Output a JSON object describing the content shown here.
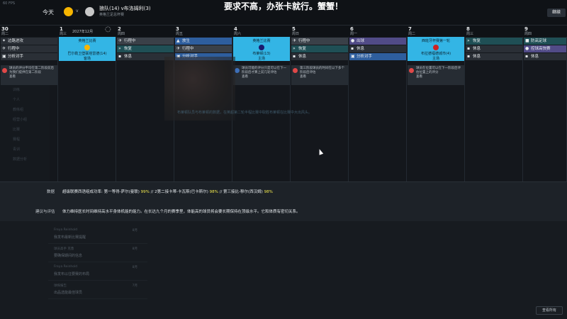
{
  "top": {
    "fps": "60 FPS",
    "today": "今天",
    "home_logo_color": "#f7b500",
    "away_logo_color": "#c8c8c8",
    "match_title": "狼队(14) v布洛姆利(3)",
    "match_sub": "英格兰足总杯赛",
    "banner": "要求不高，办张卡就行。蟹蟹！",
    "continue": "继续"
  },
  "calendar": {
    "month_label": "2027年12月",
    "days": [
      {
        "num": "30",
        "name": "周二"
      },
      {
        "num": "1",
        "name": "周三"
      },
      {
        "num": "2",
        "name": "周四"
      },
      {
        "num": "3",
        "name": "周五"
      },
      {
        "num": "4",
        "name": "周六"
      },
      {
        "num": "5",
        "name": "周日"
      },
      {
        "num": "6",
        "name": "周一"
      },
      {
        "num": "7",
        "name": "周二"
      },
      {
        "num": "8",
        "name": "周三"
      },
      {
        "num": "9",
        "name": "周四"
      }
    ],
    "col0": [
      "边路进攻",
      "行程中",
      "分析对手"
    ],
    "col1_match": {
      "title": "英格兰比赛",
      "name": "巴尔勒卫登联塔雷德(14)",
      "sub": "客场",
      "logo": "#f7b500"
    },
    "col2": [
      "行程中",
      "恢复",
      "休息"
    ],
    "col3": [
      "放生",
      "行程中",
      "分析对手"
    ],
    "col4_match": {
      "title": "英格兰比赛",
      "name": "布莱顿(13)",
      "sub": "主场",
      "logo": "#1a1a6e"
    },
    "col5": [
      "行程中",
      "恢复",
      "休息"
    ],
    "col6": [
      "出球",
      "休息",
      "分析对手"
    ],
    "col7_match": {
      "title": "西班牙杯赛第一轮",
      "name": "布拉德福德城市(4)",
      "sub": "主场",
      "logo": "#cc2222"
    },
    "col8": [
      "恢复",
      "休息",
      "休息"
    ],
    "col9": [
      "防高定球",
      "控球高快赛",
      "休息"
    ]
  },
  "notes": [
    {
      "text": "球员的评分平均在第二阶段前后为我们提供在第二阶段",
      "sub": "查看"
    },
    {
      "text": "球员可能的评分只是可以在下一阶段后才算上前几轮评估",
      "sub": "查看"
    },
    {
      "text": "第三阶段球员的时间在以下多个阶段后评估",
      "sub": "查看"
    },
    {
      "text": "球员在位置可以在下一阶段后评估位置上的评分",
      "sub": "查看"
    }
  ],
  "sidemenu": [
    "训练",
    "个人",
    "教练组",
    "经营小组",
    "比赛",
    "赛程",
    "青训",
    "数据分析"
  ],
  "photo_caption": "布莱顿队员与布莱顿的数据，在英超第二轮半程比赛中取胜布莱顿在比赛中大出风头。",
  "panel": {
    "label1": "数据",
    "text1_prefix": "超级联赛西语组成功率: 第一等得-萨尔(曼联) ",
    "val1": "99%",
    "text1_mid": " // 2第二接卡蒂-卡瓦斯(巴卡斯尔) ",
    "val2": "98%",
    "text1_mid2": " // 第三接比-穆尔(西汉姆) ",
    "val3": "98%",
    "label2": "建议与评估",
    "text2": "体力维持医长时间维持高水平身体机能的能力。在长达九个月的赛季里，体能高的球员将会要长期保持在顶级水平。它和体质有密切关系。"
  },
  "lower": [
    {
      "title": "Freya Reinhold",
      "sub": "我发布最新比赛提醒",
      "val": "8月"
    },
    {
      "title": "球员高手 克鲁",
      "sub": "要确保期间的信息",
      "val": "8月"
    },
    {
      "title": "Freya Reinhold",
      "sub": "我发布以往要赛的布局",
      "val": "8月"
    },
    {
      "title": "球探报告",
      "sub": "出品选能最佳球员",
      "val": "7月"
    }
  ],
  "view_all": "查看所有"
}
